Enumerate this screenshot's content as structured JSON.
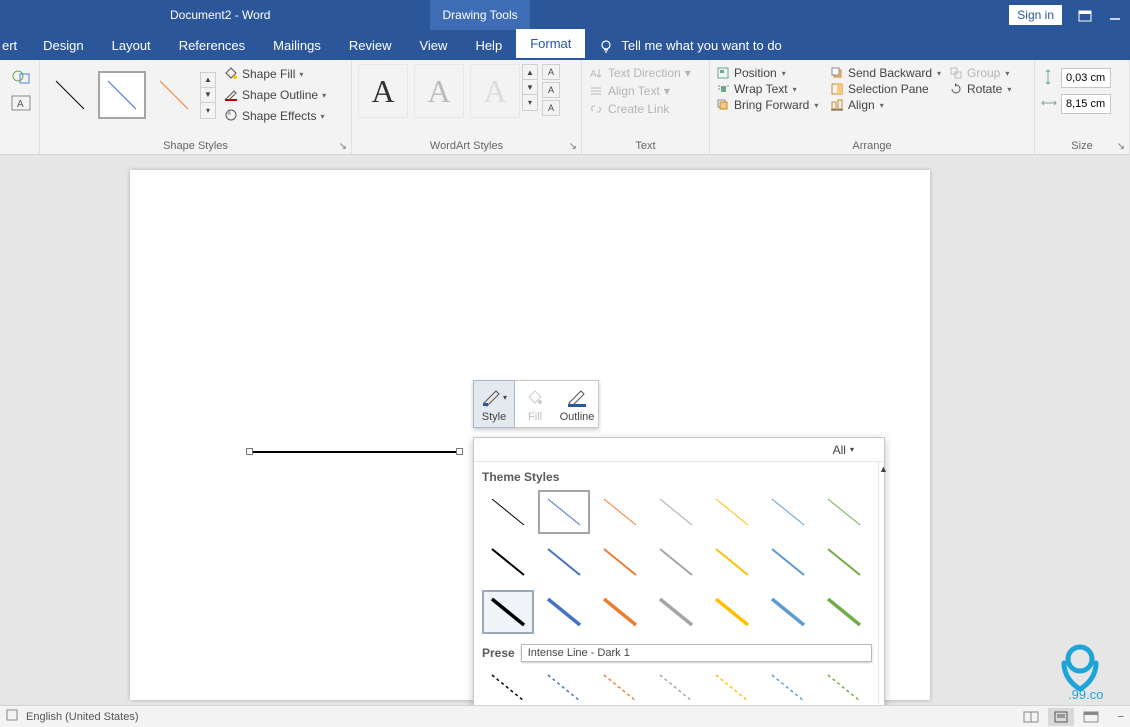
{
  "title": "Document2  -  Word",
  "titlebar": {
    "tool_tab": "Drawing Tools",
    "signin": "Sign in"
  },
  "tabs": {
    "items": [
      "ert",
      "Design",
      "Layout",
      "References",
      "Mailings",
      "Review",
      "View",
      "Help",
      "Format"
    ],
    "active": "Format",
    "tellme": "Tell me what you want to do"
  },
  "ribbon": {
    "shape_styles": {
      "label": "Shape Styles",
      "cmds": {
        "fill": "Shape Fill",
        "outline": "Shape Outline",
        "effects": "Shape Effects"
      }
    },
    "wordart": {
      "label": "WordArt Styles"
    },
    "text": {
      "label": "Text",
      "cmds": {
        "direction": "Text Direction",
        "align": "Align Text",
        "link": "Create Link"
      }
    },
    "arrange": {
      "label": "Arrange",
      "cmds": {
        "position": "Position",
        "wrap": "Wrap Text",
        "forward": "Bring Forward",
        "backward": "Send Backward",
        "selpane": "Selection Pane",
        "align": "Align",
        "group": "Group",
        "rotate": "Rotate"
      }
    },
    "size": {
      "label": "Size",
      "height": "0,03 cm",
      "width": "8,15 cm"
    }
  },
  "minibar": {
    "style": "Style",
    "fill": "Fill",
    "outline": "Outline"
  },
  "dropdown": {
    "all": "All",
    "theme_section": "Theme Styles",
    "preset_section_trunc": "Prese",
    "tooltip": "Intense Line - Dark 1",
    "colors": [
      "#000000",
      "#4472c4",
      "#ed7d31",
      "#a5a5a5",
      "#ffc000",
      "#5b9bd5",
      "#70ad47"
    ]
  },
  "status": {
    "language": "English (United States)"
  },
  "watermark": ".99.co"
}
